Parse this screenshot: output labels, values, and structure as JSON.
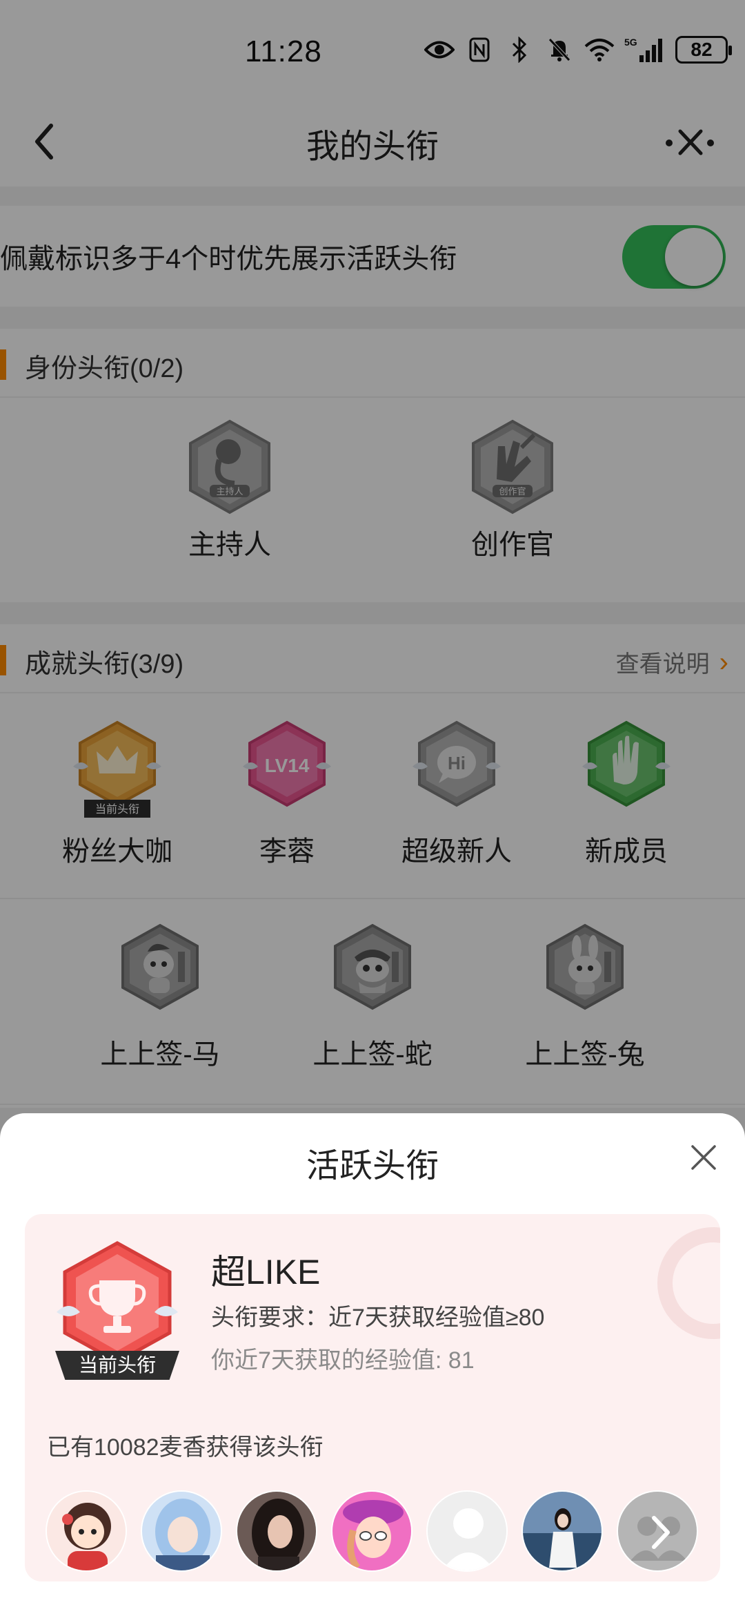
{
  "status_bar": {
    "time": "11:28",
    "icons": [
      "eye-icon",
      "nfc-icon",
      "bluetooth-icon",
      "bell-muted-icon",
      "wifi-icon",
      "signal-5g-icon"
    ],
    "network": "5G",
    "battery": "82"
  },
  "header": {
    "title": "我的头衔",
    "back_icon": "back-chevron-icon",
    "more_close_icon": "more-close-icon"
  },
  "toggle_row": {
    "label": "佩戴标识多于4个时优先展示活跃头衔",
    "enabled": true,
    "on_color": "#34c05a"
  },
  "identity_section": {
    "title": "身份头衔(0/2)",
    "badges": [
      {
        "label": "主持人",
        "badge_text": "主持人",
        "icon": "microphone-icon",
        "earned": false
      },
      {
        "label": "创作官",
        "badge_text": "创作官",
        "icon": "pen-hand-icon",
        "earned": false
      }
    ]
  },
  "achievement_section": {
    "title": "成就头衔(3/9)",
    "link_label": "查看说明",
    "current_tag": "当前头衔",
    "row1": [
      {
        "label": "粉丝大咖",
        "icon": "crown-icon",
        "color": "#f5a623",
        "earned": true,
        "current": true
      },
      {
        "label": "李蓉",
        "icon": "level-icon",
        "badge_text": "LV14",
        "color": "#e9568f",
        "earned": true,
        "current": false
      },
      {
        "label": "超级新人",
        "icon": "hi-bubble-icon",
        "badge_text": "Hi",
        "color": "#9a9a9a",
        "earned": false,
        "current": false
      },
      {
        "label": "新成员",
        "icon": "wave-hand-icon",
        "color": "#4caf50",
        "earned": true,
        "current": false
      }
    ],
    "row2": [
      {
        "label": "上上签-马",
        "icon": "horse-icon",
        "earned": false
      },
      {
        "label": "上上签-蛇",
        "icon": "snake-icon",
        "earned": false
      },
      {
        "label": "上上签-兔",
        "icon": "rabbit-icon",
        "earned": false
      }
    ]
  },
  "sheet": {
    "title": "活跃头衔",
    "close_icon": "close-icon",
    "card": {
      "name": "超LIKE",
      "requirement": "头衔要求：近7天获取经验值≥80",
      "your_exp": "你近7天获取的经验值: 81",
      "current_tag": "当前头衔",
      "owners_text": "已有10082麦香获得该头衔",
      "badge_icon": "trophy-icon",
      "badge_color": "#ef5350",
      "avatars": [
        {
          "icon": "avatar-cartoon-girl"
        },
        {
          "icon": "avatar-blue-hair"
        },
        {
          "icon": "avatar-dark-hair"
        },
        {
          "icon": "avatar-pink-hat"
        },
        {
          "icon": "avatar-default"
        },
        {
          "icon": "avatar-seaside"
        },
        {
          "icon": "avatar-more-arrow"
        }
      ]
    }
  }
}
